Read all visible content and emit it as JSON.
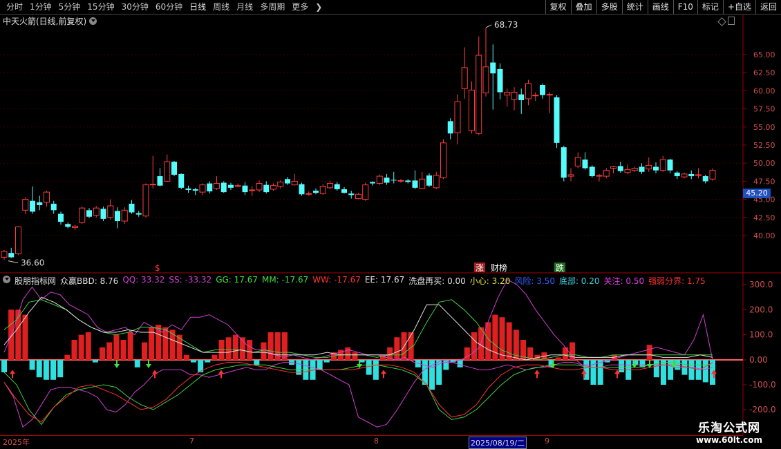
{
  "toolbar": {
    "periods": [
      "分时",
      "1分钟",
      "5分钟",
      "15分钟",
      "30分钟",
      "60分钟",
      "日线",
      "周线",
      "月线",
      "多周期",
      "更多"
    ],
    "active_period": "日线",
    "more_icon": "chevron-right-icon",
    "right_buttons": [
      "复权",
      "叠加",
      "多股",
      "统计",
      "画线",
      "F10",
      "标记",
      "+自选",
      "返回"
    ]
  },
  "stock": {
    "title": "中天火箭(日线,前复权)",
    "high_label": "68.73",
    "low_label": "36.60",
    "current_price": "45.20"
  },
  "price_axis": [
    "65.00",
    "62.50",
    "60.00",
    "57.50",
    "55.00",
    "52.50",
    "50.00",
    "47.50",
    "45.00",
    "42.50",
    "40.00"
  ],
  "events": [
    {
      "text": "$",
      "color": "#ff3030"
    },
    {
      "text": "涨",
      "color": "#ffffff",
      "bg": "#a02020"
    },
    {
      "text": "财榜",
      "color": "#ffffff"
    },
    {
      "text": "跌",
      "color": "#ffffff",
      "bg": "#207020"
    }
  ],
  "indicator": {
    "name": "股朋指标网",
    "fields": [
      {
        "label": "众赢BBD: 8.76",
        "color": "#e0e0e0"
      },
      {
        "label": "QQ: 33.32",
        "color": "#d040d0"
      },
      {
        "label": "SS: -33.32",
        "color": "#d040d0"
      },
      {
        "label": "GG: 17.67",
        "color": "#40e040"
      },
      {
        "label": "MM: -17.67",
        "color": "#40e040"
      },
      {
        "label": "WW: -17.67",
        "color": "#ff3030"
      },
      {
        "label": "EE: 17.67",
        "color": "#e0e0e0"
      },
      {
        "label": "洗盘再买: 0.00",
        "color": "#e0e0e0"
      },
      {
        "label": "小心: 3.20",
        "color": "#e0e040"
      },
      {
        "label": "风险: 3.50",
        "color": "#3060ff"
      },
      {
        "label": "底部: 0.20",
        "color": "#40d0e0"
      },
      {
        "label": "关注: 0.50",
        "color": "#e040e0"
      },
      {
        "label": "强弱分界: 1.75",
        "color": "#ff3030"
      }
    ]
  },
  "indicator_axis": [
    "300.0",
    "200.0",
    "100.0",
    "0.00",
    "-100.0",
    "-200.0"
  ],
  "dates": [
    "2025年",
    "7",
    "8",
    "2025/08/19/二",
    "9"
  ],
  "logo": {
    "title": "乐淘公式网",
    "url": "www.60lt.com"
  },
  "colors": {
    "up": "#ff3c3c",
    "down": "#54fcfc",
    "axis": "#a00000"
  }
}
